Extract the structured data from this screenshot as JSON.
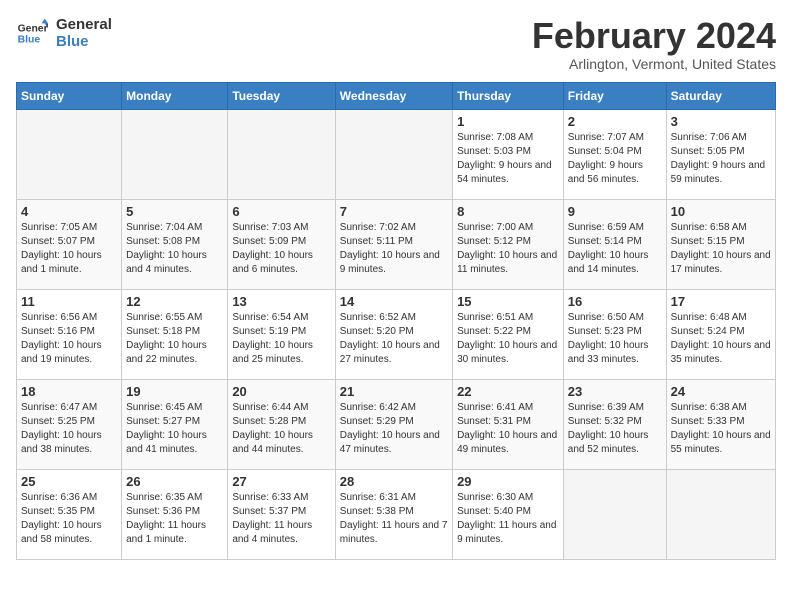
{
  "logo": {
    "line1": "General",
    "line2": "Blue"
  },
  "title": "February 2024",
  "subtitle": "Arlington, Vermont, United States",
  "days_of_week": [
    "Sunday",
    "Monday",
    "Tuesday",
    "Wednesday",
    "Thursday",
    "Friday",
    "Saturday"
  ],
  "weeks": [
    [
      {
        "day": "",
        "info": ""
      },
      {
        "day": "",
        "info": ""
      },
      {
        "day": "",
        "info": ""
      },
      {
        "day": "",
        "info": ""
      },
      {
        "day": "1",
        "info": "Sunrise: 7:08 AM\nSunset: 5:03 PM\nDaylight: 9 hours and 54 minutes."
      },
      {
        "day": "2",
        "info": "Sunrise: 7:07 AM\nSunset: 5:04 PM\nDaylight: 9 hours and 56 minutes."
      },
      {
        "day": "3",
        "info": "Sunrise: 7:06 AM\nSunset: 5:05 PM\nDaylight: 9 hours and 59 minutes."
      }
    ],
    [
      {
        "day": "4",
        "info": "Sunrise: 7:05 AM\nSunset: 5:07 PM\nDaylight: 10 hours and 1 minute."
      },
      {
        "day": "5",
        "info": "Sunrise: 7:04 AM\nSunset: 5:08 PM\nDaylight: 10 hours and 4 minutes."
      },
      {
        "day": "6",
        "info": "Sunrise: 7:03 AM\nSunset: 5:09 PM\nDaylight: 10 hours and 6 minutes."
      },
      {
        "day": "7",
        "info": "Sunrise: 7:02 AM\nSunset: 5:11 PM\nDaylight: 10 hours and 9 minutes."
      },
      {
        "day": "8",
        "info": "Sunrise: 7:00 AM\nSunset: 5:12 PM\nDaylight: 10 hours and 11 minutes."
      },
      {
        "day": "9",
        "info": "Sunrise: 6:59 AM\nSunset: 5:14 PM\nDaylight: 10 hours and 14 minutes."
      },
      {
        "day": "10",
        "info": "Sunrise: 6:58 AM\nSunset: 5:15 PM\nDaylight: 10 hours and 17 minutes."
      }
    ],
    [
      {
        "day": "11",
        "info": "Sunrise: 6:56 AM\nSunset: 5:16 PM\nDaylight: 10 hours and 19 minutes."
      },
      {
        "day": "12",
        "info": "Sunrise: 6:55 AM\nSunset: 5:18 PM\nDaylight: 10 hours and 22 minutes."
      },
      {
        "day": "13",
        "info": "Sunrise: 6:54 AM\nSunset: 5:19 PM\nDaylight: 10 hours and 25 minutes."
      },
      {
        "day": "14",
        "info": "Sunrise: 6:52 AM\nSunset: 5:20 PM\nDaylight: 10 hours and 27 minutes."
      },
      {
        "day": "15",
        "info": "Sunrise: 6:51 AM\nSunset: 5:22 PM\nDaylight: 10 hours and 30 minutes."
      },
      {
        "day": "16",
        "info": "Sunrise: 6:50 AM\nSunset: 5:23 PM\nDaylight: 10 hours and 33 minutes."
      },
      {
        "day": "17",
        "info": "Sunrise: 6:48 AM\nSunset: 5:24 PM\nDaylight: 10 hours and 35 minutes."
      }
    ],
    [
      {
        "day": "18",
        "info": "Sunrise: 6:47 AM\nSunset: 5:25 PM\nDaylight: 10 hours and 38 minutes."
      },
      {
        "day": "19",
        "info": "Sunrise: 6:45 AM\nSunset: 5:27 PM\nDaylight: 10 hours and 41 minutes."
      },
      {
        "day": "20",
        "info": "Sunrise: 6:44 AM\nSunset: 5:28 PM\nDaylight: 10 hours and 44 minutes."
      },
      {
        "day": "21",
        "info": "Sunrise: 6:42 AM\nSunset: 5:29 PM\nDaylight: 10 hours and 47 minutes."
      },
      {
        "day": "22",
        "info": "Sunrise: 6:41 AM\nSunset: 5:31 PM\nDaylight: 10 hours and 49 minutes."
      },
      {
        "day": "23",
        "info": "Sunrise: 6:39 AM\nSunset: 5:32 PM\nDaylight: 10 hours and 52 minutes."
      },
      {
        "day": "24",
        "info": "Sunrise: 6:38 AM\nSunset: 5:33 PM\nDaylight: 10 hours and 55 minutes."
      }
    ],
    [
      {
        "day": "25",
        "info": "Sunrise: 6:36 AM\nSunset: 5:35 PM\nDaylight: 10 hours and 58 minutes."
      },
      {
        "day": "26",
        "info": "Sunrise: 6:35 AM\nSunset: 5:36 PM\nDaylight: 11 hours and 1 minute."
      },
      {
        "day": "27",
        "info": "Sunrise: 6:33 AM\nSunset: 5:37 PM\nDaylight: 11 hours and 4 minutes."
      },
      {
        "day": "28",
        "info": "Sunrise: 6:31 AM\nSunset: 5:38 PM\nDaylight: 11 hours and 7 minutes."
      },
      {
        "day": "29",
        "info": "Sunrise: 6:30 AM\nSunset: 5:40 PM\nDaylight: 11 hours and 9 minutes."
      },
      {
        "day": "",
        "info": ""
      },
      {
        "day": "",
        "info": ""
      }
    ]
  ]
}
